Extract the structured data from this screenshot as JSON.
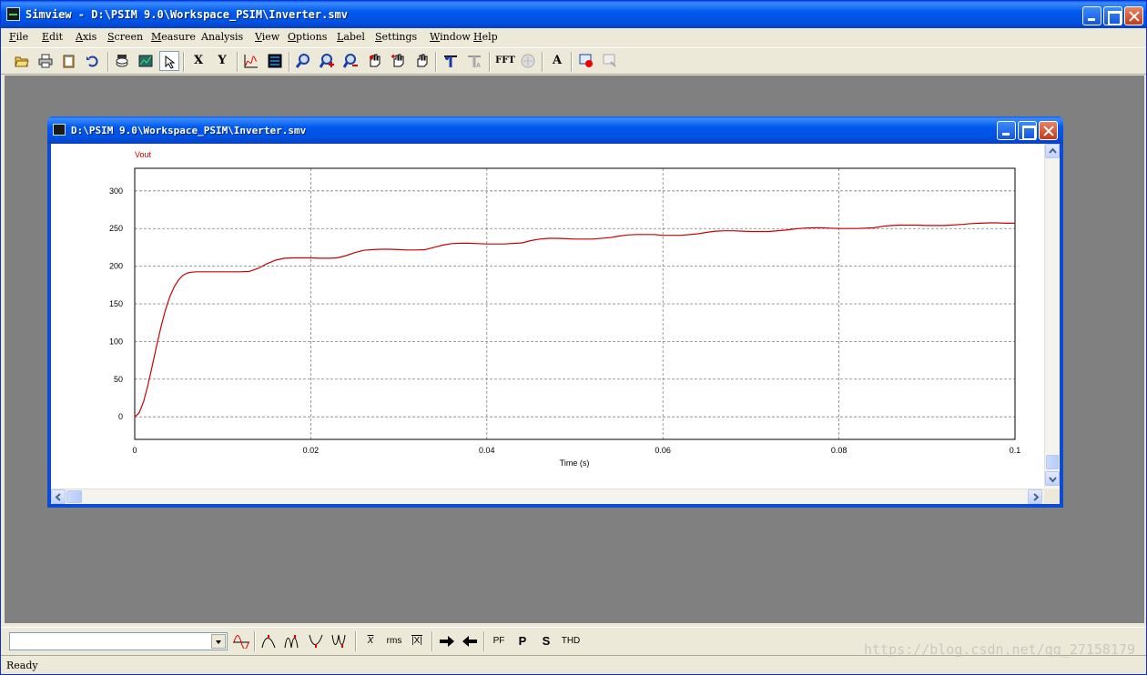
{
  "app": {
    "title": "Simview - D:\\PSIM 9.0\\Workspace_PSIM\\Inverter.smv"
  },
  "menu": [
    {
      "label": "File",
      "key": "F",
      "rest": "ile"
    },
    {
      "label": "Edit",
      "key": "E",
      "rest": "dit"
    },
    {
      "label": "Axis",
      "key": "A",
      "rest": "xis"
    },
    {
      "label": "Screen",
      "key": "S",
      "rest": "creen"
    },
    {
      "label": "Measure",
      "key": "M",
      "rest": "easure"
    },
    {
      "label": "Analysis",
      "key": "",
      "rest": "Analysis"
    },
    {
      "label": "View",
      "key": "V",
      "rest": "iew"
    },
    {
      "label": "Options",
      "key": "O",
      "rest": "ptions"
    },
    {
      "label": "Label",
      "key": "L",
      "rest": "abel"
    },
    {
      "label": "Settings",
      "key": "S",
      "rest": "ettings"
    },
    {
      "label": "Window",
      "key": "W",
      "rest": "indow"
    },
    {
      "label": "Help",
      "key": "H",
      "rest": "elp"
    }
  ],
  "toolbar": {
    "x_label": "X",
    "y_label": "Y",
    "fft_label": "FFT",
    "text_label": "A",
    "icons": [
      "open-icon",
      "print-icon",
      "clipboard-icon",
      "undo-icon",
      "data-icon",
      "screen-icon",
      "select-cursor-icon",
      "x-axis-button",
      "y-axis-button",
      "curve-icon",
      "table-icon",
      "zoom-icon",
      "zoom-in-icon",
      "zoom-out-icon",
      "pan-icon",
      "hand-plus-icon",
      "hand-icon",
      "measure-icon",
      "measure-disabled-icon",
      "fft-button",
      "fft-disabled-icon",
      "text-button",
      "record-icon",
      "record-disabled-icon"
    ]
  },
  "child": {
    "title": "D:\\PSIM 9.0\\Workspace_PSIM\\Inverter.smv"
  },
  "bottombar": {
    "combo_value": "",
    "rms_label": "rms",
    "absavg_label": "|X|",
    "xbar_label": "X",
    "pf_label": "PF",
    "p_label": "P",
    "s_label": "S",
    "thd_label": "THD"
  },
  "status": {
    "text": "Ready",
    "watermark": "https://blog.csdn.net/qq_27158179"
  },
  "colors": {
    "trace": "#cc0000",
    "grid": "#808080",
    "mdi_background": "#808080"
  },
  "chart_data": {
    "type": "line",
    "series": [
      {
        "name": "Vout",
        "x": [
          0,
          0.0005,
          0.001,
          0.0015,
          0.002,
          0.0025,
          0.003,
          0.0035,
          0.004,
          0.0045,
          0.005,
          0.0055,
          0.006,
          0.0065,
          0.007,
          0.008,
          0.009,
          0.01,
          0.011,
          0.012,
          0.013,
          0.014,
          0.015,
          0.016,
          0.017,
          0.018,
          0.019,
          0.02,
          0.021,
          0.022,
          0.023,
          0.024,
          0.025,
          0.026,
          0.027,
          0.028,
          0.029,
          0.03,
          0.031,
          0.032,
          0.033,
          0.034,
          0.035,
          0.036,
          0.037,
          0.038,
          0.039,
          0.04,
          0.042,
          0.044,
          0.045,
          0.046,
          0.047,
          0.048,
          0.049,
          0.05,
          0.052,
          0.054,
          0.055,
          0.056,
          0.057,
          0.058,
          0.059,
          0.06,
          0.062,
          0.064,
          0.065,
          0.066,
          0.067,
          0.068,
          0.069,
          0.07,
          0.072,
          0.074,
          0.075,
          0.076,
          0.077,
          0.078,
          0.079,
          0.08,
          0.082,
          0.084,
          0.085,
          0.086,
          0.087,
          0.088,
          0.089,
          0.09,
          0.092,
          0.094,
          0.095,
          0.096,
          0.097,
          0.098,
          0.099,
          0.1
        ],
        "y": [
          0,
          5,
          20,
          42,
          68,
          95,
          120,
          142,
          160,
          173,
          182,
          188,
          191,
          192,
          192.5,
          192.5,
          192.5,
          192.5,
          192.5,
          192.5,
          193,
          197,
          203,
          208,
          210.5,
          211,
          211,
          211,
          210.5,
          210.5,
          211,
          214,
          218,
          221,
          222,
          222.5,
          222.5,
          222,
          221.5,
          221.5,
          222,
          225,
          228,
          230,
          230.5,
          230.5,
          230,
          229.5,
          229.5,
          231,
          234,
          236,
          237,
          237,
          236.5,
          236,
          236,
          238,
          240,
          241.5,
          242,
          242,
          242,
          241,
          241,
          243,
          245,
          246.5,
          247,
          247,
          246.5,
          246,
          246,
          248,
          249.5,
          250.5,
          251,
          251,
          250.5,
          250,
          250,
          251,
          253,
          254,
          254.5,
          254.5,
          254.5,
          254,
          254,
          255.5,
          256.5,
          257,
          257.5,
          257.5,
          257,
          257
        ]
      }
    ],
    "xlabel": "Time (s)",
    "ylabel": "",
    "xlim": [
      0,
      0.1
    ],
    "ylim": [
      -30,
      330
    ],
    "xticks": [
      0,
      0.02,
      0.04,
      0.06,
      0.08,
      0.1
    ],
    "xtick_labels": [
      "0",
      "0.02",
      "0.04",
      "0.06",
      "0.08",
      "0.1"
    ],
    "yticks": [
      0,
      50,
      100,
      150,
      200,
      250,
      300
    ],
    "ytick_labels": [
      "0",
      "50",
      "100",
      "150",
      "200",
      "250",
      "300"
    ],
    "grid": true,
    "legend": "top-left"
  }
}
